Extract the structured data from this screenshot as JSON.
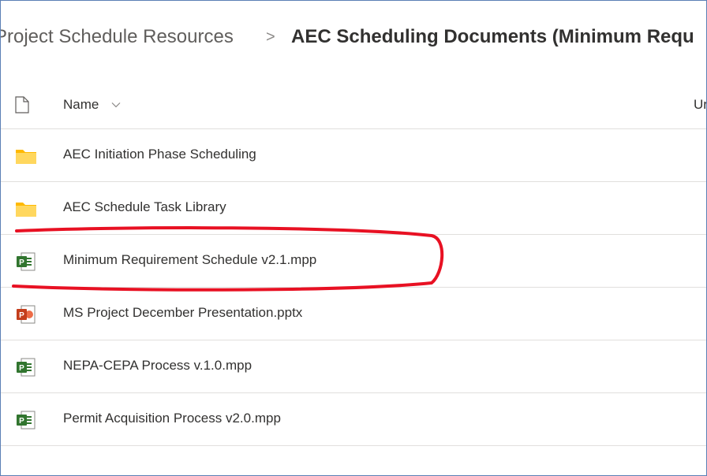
{
  "breadcrumb": {
    "parent": "Project Schedule Resources",
    "separator": ">",
    "current": "AEC Scheduling Documents (Minimum Requ"
  },
  "header": {
    "name_label": "Name",
    "partial_column_label": "Ur"
  },
  "files": [
    {
      "name": "AEC Initiation Phase Scheduling",
      "type": "folder",
      "icon": "folder-icon"
    },
    {
      "name": "AEC Schedule Task Library",
      "type": "folder",
      "icon": "folder-icon"
    },
    {
      "name": "Minimum Requirement Schedule v2.1.mpp",
      "type": "mpp",
      "icon": "project-file-icon",
      "highlighted": true
    },
    {
      "name": "MS Project December Presentation.pptx",
      "type": "pptx",
      "icon": "powerpoint-file-icon"
    },
    {
      "name": "NEPA-CEPA Process v.1.0.mpp",
      "type": "mpp",
      "icon": "project-file-icon"
    },
    {
      "name": "Permit Acquisition Process v2.0.mpp",
      "type": "mpp",
      "icon": "project-file-icon"
    }
  ],
  "colors": {
    "folder": "#ffce3d",
    "project": "#31752f",
    "powerpoint": "#c43e1c",
    "highlight": "#e81123"
  }
}
